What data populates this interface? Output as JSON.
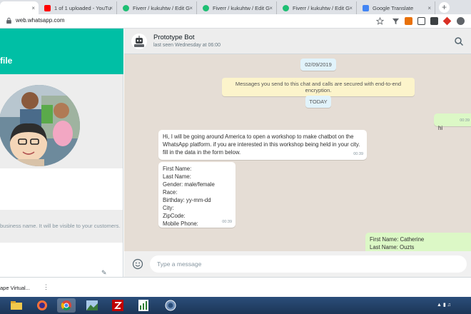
{
  "browser": {
    "tabs": [
      {
        "label": "",
        "favicon": "whatsapp-icon",
        "active": true
      },
      {
        "label": "1 of 1 uploaded - YouTu",
        "favicon": "youtube-icon",
        "active": false
      },
      {
        "label": "Fiverr / kukuhtw / Edit G",
        "favicon": "fiverr-icon",
        "active": false
      },
      {
        "label": "Fiverr / kukuhtw / Edit G",
        "favicon": "fiverr-icon",
        "active": false
      },
      {
        "label": "Fiverr / kukuhtw / Edit G",
        "favicon": "fiverr-icon",
        "active": false
      },
      {
        "label": "Google Translate",
        "favicon": "translate-icon",
        "active": false
      }
    ],
    "tab_close": "×",
    "new_tab": "+",
    "url": "web.whatsapp.com"
  },
  "profile": {
    "title": "file",
    "business_desc": "business name. It will be visible to your customers."
  },
  "chat": {
    "contact_name": "Prototype Bot",
    "last_seen": "last seen Wednesday at 06:00",
    "date_pill": "02/09/2019",
    "encryption_notice": "Messages you send to this chat and calls are secured with end-to-end encryption.",
    "today_pill": "TODAY",
    "messages": [
      {
        "direction": "out",
        "text": "hi",
        "time": "00:39"
      },
      {
        "direction": "in",
        "text": "Hi, I will be going around America to open a workshop to make chatbot on the WhatsApp platform. if you are interested in this workshop being held in your city. fill in the data in the form below.",
        "time": "00:39"
      },
      {
        "direction": "in",
        "text": "First Name:\nLast Name:\nGender: male/female\nRace:\nBirthday: yy-mm-dd\nCity:\nZipCode:\nMobile Phone:",
        "time": "00:39"
      },
      {
        "direction": "out",
        "text": "First Name: Catherine\nLast Name: Ouzts",
        "time": ""
      }
    ],
    "input_placeholder": "Type a message"
  },
  "downloads": {
    "item": "ape Virtual..."
  },
  "colors": {
    "accent": "#00bfa5",
    "chat_bg": "#e5ddd5",
    "outgoing": "#dcf8c6",
    "notice": "#fcf4cb",
    "pill": "#e1f3fb"
  }
}
